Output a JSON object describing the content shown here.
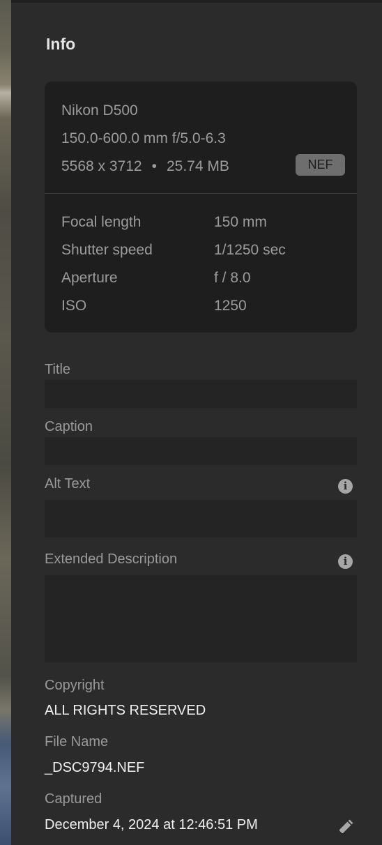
{
  "panel": {
    "title": "Info"
  },
  "camera_card": {
    "camera": "Nikon D500",
    "lens": "150.0-600.0 mm f/5.0-6.3",
    "dimensions": "5568 x 3712",
    "separator": "•",
    "file_size": "25.74 MB",
    "file_type_badge": "NEF",
    "exif": [
      {
        "label": "Focal length",
        "value": "150 mm"
      },
      {
        "label": "Shutter speed",
        "value": "1/1250 sec"
      },
      {
        "label": "Aperture",
        "value": "f / 8.0"
      },
      {
        "label": "ISO",
        "value": "1250"
      }
    ]
  },
  "fields": {
    "title_label": "Title",
    "title_value": "",
    "caption_label": "Caption",
    "caption_value": "",
    "alt_text_label": "Alt Text",
    "alt_text_value": "",
    "extended_description_label": "Extended Description",
    "extended_description_value": "",
    "copyright_label": "Copyright",
    "copyright_value": "ALL RIGHTS RESERVED",
    "file_name_label": "File Name",
    "file_name_value": "_DSC9794.NEF",
    "captured_label": "Captured",
    "captured_value": "December 4, 2024 at 12:46:51 PM"
  },
  "icons": {
    "info": "info-icon",
    "edit": "pencil-icon",
    "info_glyph": "i"
  }
}
